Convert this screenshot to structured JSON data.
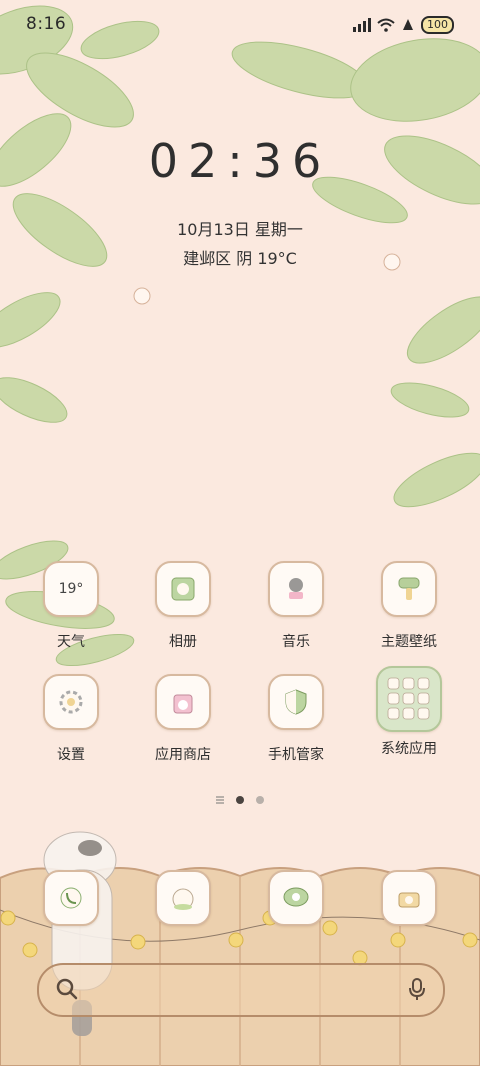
{
  "status": {
    "time": "8:16",
    "battery": "100"
  },
  "clock": {
    "time": "02:36",
    "date": "10月13日 星期一",
    "location_weather": "建邺区 阴 19°C"
  },
  "apps_row1": [
    {
      "label": "天气",
      "icon": "weather-icon",
      "text": "19°"
    },
    {
      "label": "相册",
      "icon": "photo-album-icon"
    },
    {
      "label": "音乐",
      "icon": "music-icon"
    },
    {
      "label": "主题壁纸",
      "icon": "theme-wallpaper-icon"
    }
  ],
  "apps_row2": [
    {
      "label": "设置",
      "icon": "settings-icon"
    },
    {
      "label": "应用商店",
      "icon": "app-store-icon"
    },
    {
      "label": "手机管家",
      "icon": "phone-manager-icon"
    },
    {
      "label": "系统应用",
      "icon": "system-apps-folder-icon"
    }
  ],
  "dock": [
    {
      "icon": "phone-icon"
    },
    {
      "icon": "contacts-icon"
    },
    {
      "icon": "messages-icon"
    },
    {
      "icon": "camera-icon"
    }
  ],
  "pages": {
    "count": 2,
    "active": 1
  },
  "colors": {
    "background": "#fbe9df",
    "leaf": "#c7d6a4",
    "fence": "#e9c9a4",
    "accent": "#b58c6a"
  }
}
